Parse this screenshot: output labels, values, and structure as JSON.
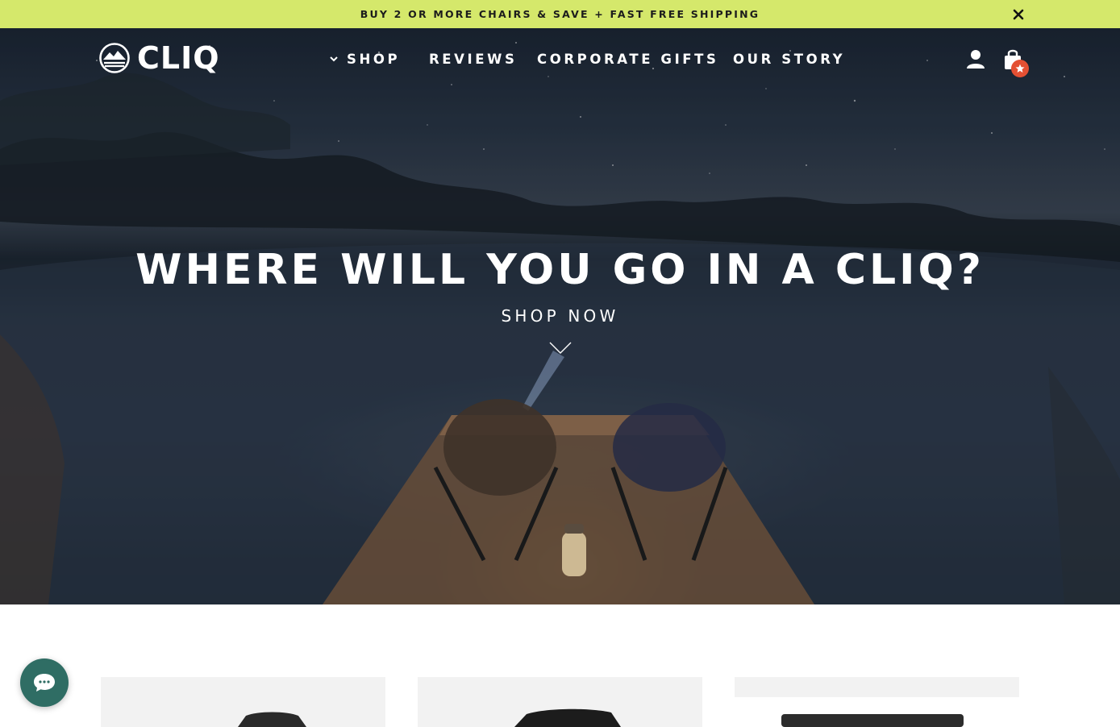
{
  "announcement": {
    "text": "BUY 2 OR MORE CHAIRS & SAVE + FAST FREE SHIPPING",
    "close_icon": "close-icon",
    "background": "#d5e86b"
  },
  "header": {
    "logo_text": "CLIQ",
    "nav": [
      {
        "label": "SHOP",
        "has_dropdown": true
      },
      {
        "label": "REVIEWS"
      },
      {
        "label": "CORPORATE GIFTS"
      },
      {
        "label": "OUR STORY"
      }
    ],
    "account_icon": "account-icon",
    "cart_icon": "cart-icon",
    "cart_badge_icon": "star-icon",
    "badge_color": "#e45033"
  },
  "hero": {
    "title": "WHERE WILL YOU GO IN A CLIQ?",
    "cta": "SHOP NOW",
    "arrow_icon": "chevron-down-icon"
  },
  "products": [
    {
      "name": "product-card-1"
    },
    {
      "name": "product-card-2"
    },
    {
      "name": "product-card-3"
    }
  ],
  "chat_widget": {
    "icon": "chat-bubble-icon",
    "color": "#2f6d64"
  }
}
